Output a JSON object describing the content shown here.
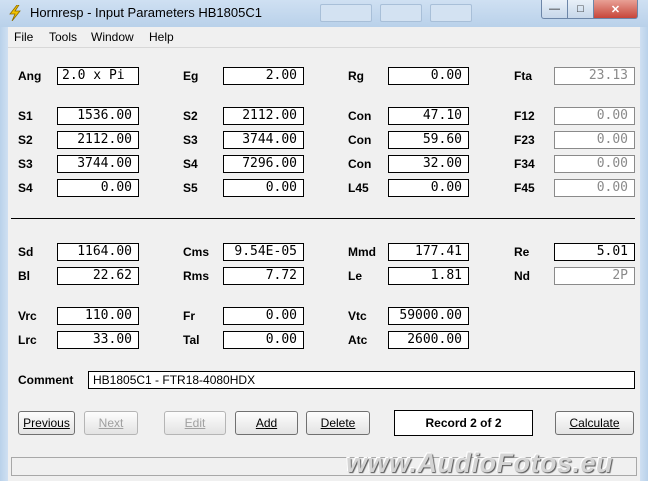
{
  "window": {
    "title": "Hornresp - Input Parameters   HB1805C1"
  },
  "menu": [
    "File",
    "Tools",
    "Window",
    "Help"
  ],
  "fields": {
    "ang": {
      "label": "Ang",
      "value": "2.0 x Pi"
    },
    "eg": {
      "label": "Eg",
      "value": "2.00"
    },
    "rg": {
      "label": "Rg",
      "value": "0.00"
    },
    "fta": {
      "label": "Fta",
      "value": "23.13"
    },
    "s1": {
      "label": "S1",
      "value": "1536.00"
    },
    "s2a": {
      "label": "S2",
      "value": "2112.00"
    },
    "con1": {
      "label": "Con",
      "value": "47.10"
    },
    "f12": {
      "label": "F12",
      "value": "0.00"
    },
    "s2b": {
      "label": "S2",
      "value": "2112.00"
    },
    "s3a": {
      "label": "S3",
      "value": "3744.00"
    },
    "con2": {
      "label": "Con",
      "value": "59.60"
    },
    "f23": {
      "label": "F23",
      "value": "0.00"
    },
    "s3b": {
      "label": "S3",
      "value": "3744.00"
    },
    "s4a": {
      "label": "S4",
      "value": "7296.00"
    },
    "con3": {
      "label": "Con",
      "value": "32.00"
    },
    "f34": {
      "label": "F34",
      "value": "0.00"
    },
    "s4b": {
      "label": "S4",
      "value": "0.00"
    },
    "s5": {
      "label": "S5",
      "value": "0.00"
    },
    "l45": {
      "label": "L45",
      "value": "0.00"
    },
    "f45": {
      "label": "F45",
      "value": "0.00"
    },
    "sd": {
      "label": "Sd",
      "value": "1164.00"
    },
    "cms": {
      "label": "Cms",
      "value": "9.54E-05"
    },
    "mmd": {
      "label": "Mmd",
      "value": "177.41"
    },
    "re": {
      "label": "Re",
      "value": "5.01"
    },
    "bl": {
      "label": "Bl",
      "value": "22.62"
    },
    "rms": {
      "label": "Rms",
      "value": "7.72"
    },
    "le": {
      "label": "Le",
      "value": "1.81"
    },
    "nd": {
      "label": "Nd",
      "value": "2P"
    },
    "vrc": {
      "label": "Vrc",
      "value": "110.00"
    },
    "fr": {
      "label": "Fr",
      "value": "0.00"
    },
    "vtc": {
      "label": "Vtc",
      "value": "59000.00"
    },
    "lrc": {
      "label": "Lrc",
      "value": "33.00"
    },
    "tal": {
      "label": "Tal",
      "value": "0.00"
    },
    "atc": {
      "label": "Atc",
      "value": "2600.00"
    }
  },
  "comment": {
    "label": "Comment",
    "value": "HB1805C1 - FTR18-4080HDX"
  },
  "buttons": {
    "previous": "Previous",
    "next": "Next",
    "edit": "Edit",
    "add": "Add",
    "delete": "Delete",
    "calculate": "Calculate"
  },
  "record": "Record 2 of 2",
  "watermark": "www.AudioFotos.eu"
}
